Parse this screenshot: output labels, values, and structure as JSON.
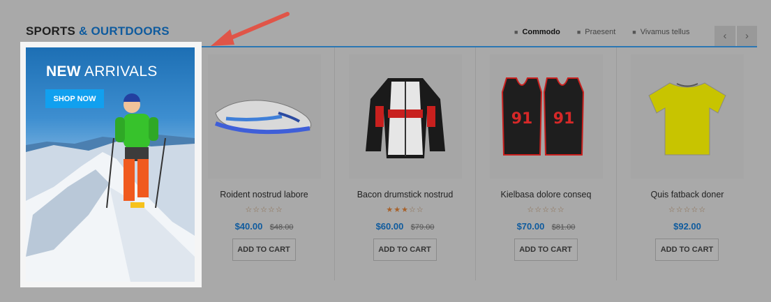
{
  "section": {
    "title_part1": "SPORTS",
    "title_amp": "&",
    "title_part2": "OURTDOORS"
  },
  "tabs": [
    {
      "label": "Commodo",
      "active": true
    },
    {
      "label": "Praesent",
      "active": false
    },
    {
      "label": "Vivamus tellus",
      "active": false
    }
  ],
  "nav": {
    "prev_icon": "chevron-left-icon",
    "next_icon": "chevron-right-icon"
  },
  "banner": {
    "heading_bold": "NEW",
    "heading_rest": "ARRIVALS",
    "button_label": "SHOP NOW"
  },
  "products": [
    {
      "name": "Roident nostrud labore",
      "rating": 0,
      "price": "$40.00",
      "old_price": "$48.00",
      "button": "ADD TO CART",
      "image": "soccer-cleat"
    },
    {
      "name": "Bacon drumstick nostrud",
      "rating": 3,
      "price": "$60.00",
      "old_price": "$79.00",
      "button": "ADD TO CART",
      "image": "racing-jacket"
    },
    {
      "name": "Kielbasa dolore conseq",
      "rating": 0,
      "price": "$70.00",
      "old_price": "$81.00",
      "button": "ADD TO CART",
      "image": "basketball-jerseys"
    },
    {
      "name": "Quis fatback doner",
      "rating": 0,
      "price": "$92.00",
      "old_price": "",
      "button": "ADD TO CART",
      "image": "yellow-tshirt"
    }
  ],
  "colors": {
    "accent": "#0f5b9e",
    "shop_button": "#11a0ef",
    "arrow": "#e05548",
    "overlay": "#a9a9a9"
  }
}
